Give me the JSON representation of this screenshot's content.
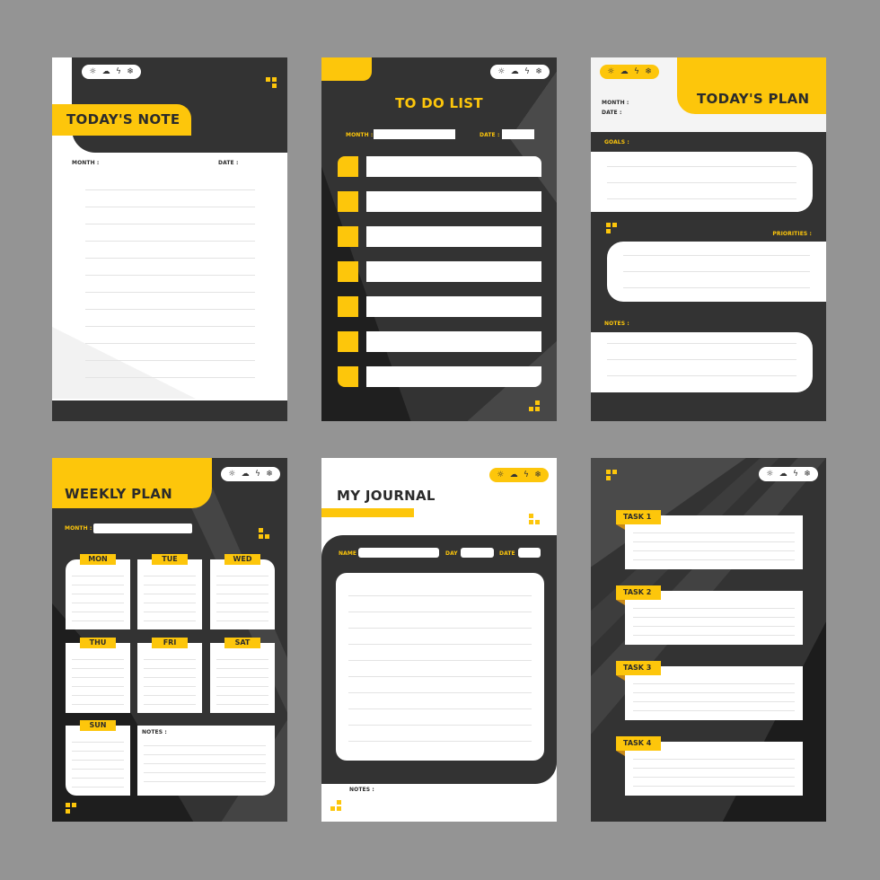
{
  "colors": {
    "background": "#949494",
    "accent_yellow": "#fdc60b",
    "dark": "#333333",
    "white": "#ffffff",
    "rule_line": "#e3e3e3"
  },
  "weather_icons": [
    {
      "name": "sun-icon",
      "glyph": "☼"
    },
    {
      "name": "rain-cloud-icon",
      "glyph": "☁"
    },
    {
      "name": "storm-icon",
      "glyph": "ϟ"
    },
    {
      "name": "snowflake-icon",
      "glyph": "❄"
    }
  ],
  "cards": {
    "todays_note": {
      "title": "TODAY'S NOTE",
      "month_label": "MONTH :",
      "date_label": "DATE :",
      "line_count": 12
    },
    "to_do_list": {
      "title": "TO DO LIST",
      "month_label": "MONTH :",
      "date_label": "DATE :",
      "item_count": 7
    },
    "todays_plan": {
      "title": "TODAY'S PLAN",
      "month_label": "MONTH :",
      "date_label": "DATE :",
      "goals_label": "GOALS :",
      "priorities_label": "PRIORITIES :",
      "notes_label": "NOTES :"
    },
    "weekly_plan": {
      "title": "WEEKLY PLAN",
      "month_label": "MONTH :",
      "days": [
        "MON",
        "TUE",
        "WED",
        "THU",
        "FRI",
        "SAT",
        "SUN"
      ],
      "notes_label": "NOTES :"
    },
    "my_journal": {
      "title": "MY JOURNAL",
      "name_label": "NAME",
      "day_label": "DAY",
      "date_label": "DATE",
      "notes_label": "NOTES :",
      "line_count": 10
    },
    "tasks": {
      "tasks": [
        "TASK 1",
        "TASK 2",
        "TASK 3",
        "TASK 4"
      ]
    }
  }
}
